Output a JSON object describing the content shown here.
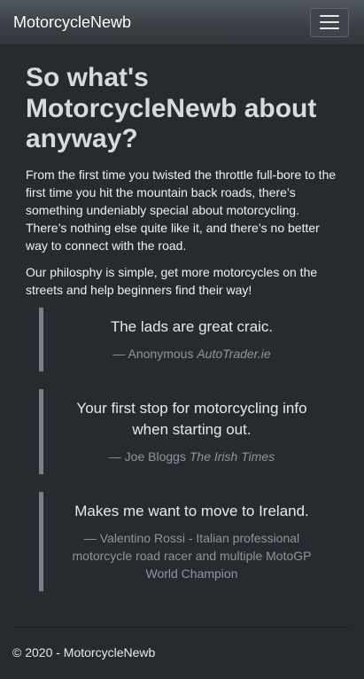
{
  "navbar": {
    "brand": "MotorcycleNewb",
    "toggle_icon": "hamburger-menu-icon"
  },
  "main": {
    "heading": "So what's MotorcycleNewb about anyway?",
    "paragraphs": [
      "From the first time you twisted the throttle full-bore to the first time you hit the mountain back roads, there’s something undeniably special about motorcycling. There’s nothing else quite like it, and there’s no better way to connect with the road.",
      "Our philosphy is simple, get more motorcycles on the streets and help beginners find their way!"
    ],
    "testimonials": [
      {
        "quote": "The lads are great craic.",
        "author": "— Anonymous",
        "source": "AutoTrader.ie"
      },
      {
        "quote": "Your first stop for motorcycling info when starting out.",
        "author": "— Joe Bloggs",
        "source": "The Irish Times"
      },
      {
        "quote": "Makes me want to move to Ireland.",
        "author": "— Valentino Rossi - Italian professional motorcycle road racer and multiple MotoGP World Champion",
        "source": ""
      }
    ]
  },
  "footer": {
    "text": "© 2020 - MotorcycleNewb"
  },
  "colors": {
    "background": "#272b30",
    "navbar": "#3a3f44",
    "quote_border": "#7a8288",
    "muted": "#8e959b"
  }
}
